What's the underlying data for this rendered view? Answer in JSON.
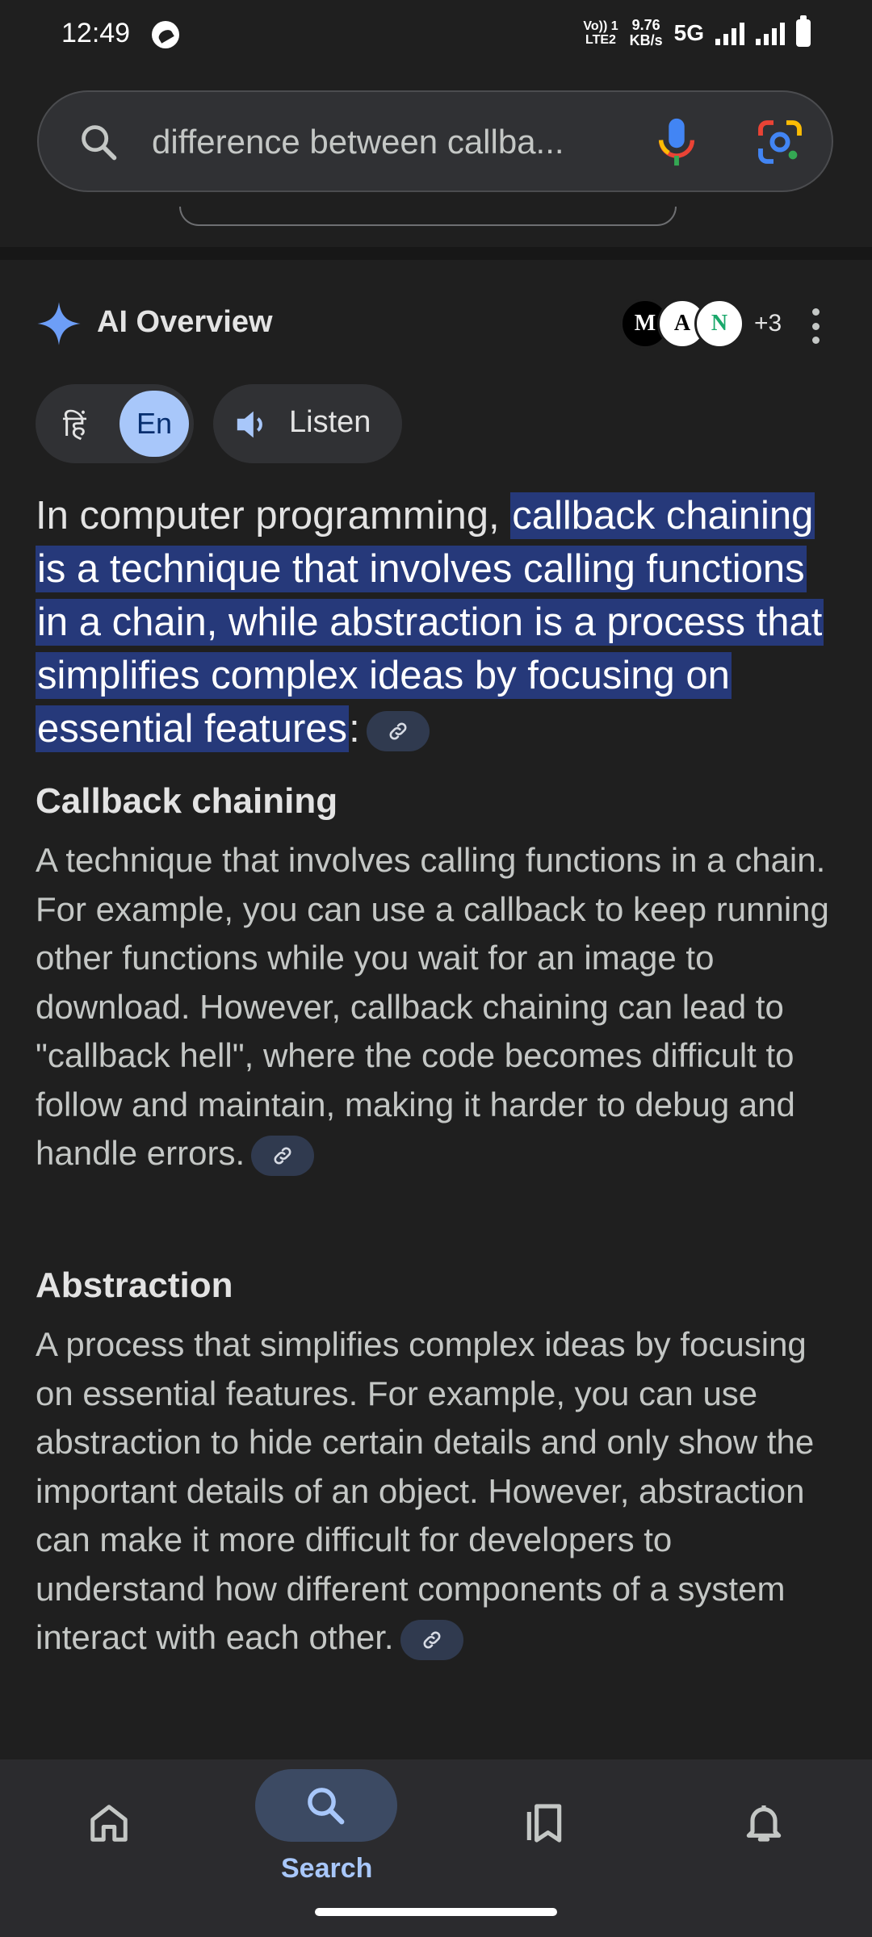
{
  "status_bar": {
    "time": "12:49",
    "lte_line1": "Vo)) 1",
    "lte_line2": "LTE2",
    "net_speed_value": "9.76",
    "net_speed_unit": "KB/s",
    "network_type": "5G"
  },
  "search": {
    "query": "difference between callba..."
  },
  "ai_overview": {
    "title": "AI Overview",
    "sources_extra_count": "+3",
    "source_avatars": [
      "M",
      "A",
      "N"
    ],
    "language_hindi": "हिं",
    "language_english": "En",
    "listen_label": "Listen",
    "lead_prefix": "In computer programming, ",
    "lead_highlight": "callback chaining is a technique that involves calling functions in a chain, while abstraction is a process that simplifies complex ideas by focusing on essential features",
    "lead_suffix": ":",
    "sections": [
      {
        "heading": "Callback chaining",
        "body": "A technique that involves calling functions in a chain. For example, you can use a callback to keep running other functions while you wait for an image to download. However, callback chaining can lead to \"callback hell\", where the code becomes difficult to follow and maintain, making it harder to debug and handle errors."
      },
      {
        "heading": "Abstraction",
        "body": "A process that simplifies complex ideas by focusing on essential features. For example, you can use abstraction to hide certain details and only show the important details of an object. However, abstraction can make it more difficult for developers to understand how different components of a system interact with each other."
      }
    ]
  },
  "bottom_nav": {
    "items": [
      {
        "icon": "home-icon",
        "label": ""
      },
      {
        "icon": "search-icon",
        "label": "Search",
        "active": true
      },
      {
        "icon": "saved-icon",
        "label": ""
      },
      {
        "icon": "notifications-icon",
        "label": ""
      }
    ]
  },
  "colors": {
    "background": "#1f1f1f",
    "highlight": "#26397a",
    "accent": "#a8c7fa"
  }
}
